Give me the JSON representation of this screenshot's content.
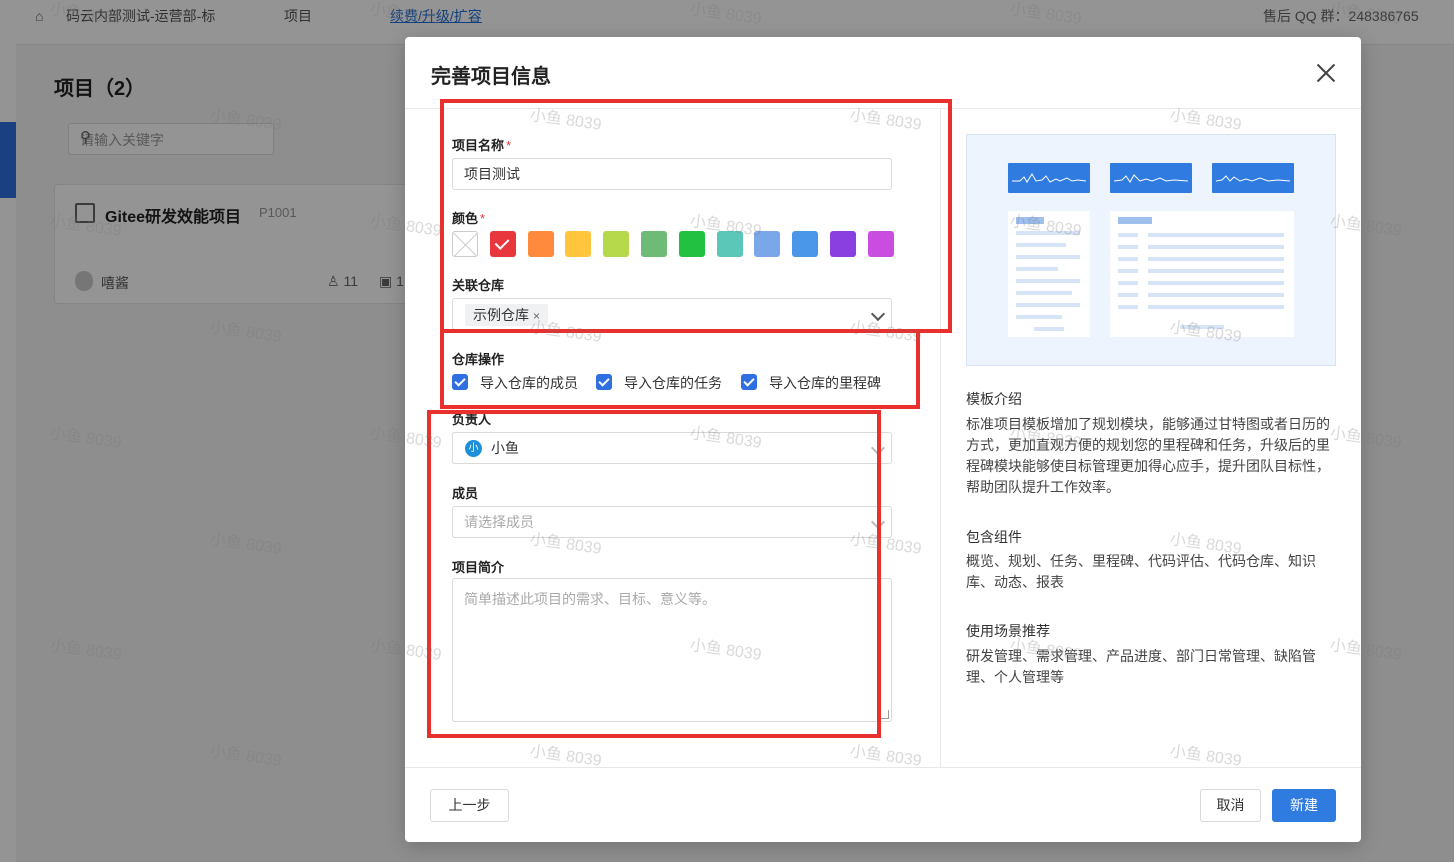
{
  "background": {
    "breadcrumb_workspace": "码云内部测试-运营部-标",
    "breadcrumb_section": "项目",
    "renew_link": "续费/升级/扩容",
    "qq_group": "售后 QQ 群：248386765",
    "page_title": "项目（2）",
    "search_placeholder": "请输入关键字",
    "project_card": {
      "name": "Gitee研发效能项目",
      "code": "P1001",
      "owner": "嘻酱",
      "members": "11",
      "extra": "1"
    }
  },
  "watermark_text": "小鱼 8039",
  "modal": {
    "title": "完善项目信息",
    "form": {
      "name_label": "项目名称",
      "name_value": "项目测试",
      "color_label": "颜色",
      "colors": [
        "none",
        "#e8383d",
        "#ff8a3d",
        "#ffc53d",
        "#b6d94c",
        "#6dbb76",
        "#22c142",
        "#5bc7b8",
        "#7aa7e8",
        "#4a96e8",
        "#8a3fe0",
        "#c94ee0"
      ],
      "selected_color_index": 1,
      "repo_label": "关联仓库",
      "repo_tag": "示例仓库",
      "repo_tag_remove": "×",
      "repo_ops_label": "仓库操作",
      "repo_ops": [
        "导入仓库的成员",
        "导入仓库的任务",
        "导入仓库的里程碑"
      ],
      "owner_label": "负责人",
      "owner_avatar": "小",
      "owner_value": "小鱼",
      "members_label": "成员",
      "members_placeholder": "请选择成员",
      "desc_label": "项目简介",
      "desc_placeholder": "简单描述此项目的需求、目标、意义等。"
    },
    "template": {
      "intro_title": "模板介绍",
      "intro_body": "标准项目模板增加了规划模块，能够通过甘特图或者日历的方式，更加直观方便的规划您的里程碑和任务，升级后的里程碑模块能够使目标管理更加得心应手，提升团队目标性，帮助团队提升工作效率。",
      "components_title": "包含组件",
      "components_body": "概览、规划、任务、里程碑、代码评估、代码仓库、知识库、动态、报表",
      "scenes_title": "使用场景推荐",
      "scenes_body": "研发管理、需求管理、产品进度、部门日常管理、缺陷管理、个人管理等"
    },
    "footer": {
      "prev_label": "上一步",
      "cancel_label": "取消",
      "create_label": "新建"
    }
  }
}
